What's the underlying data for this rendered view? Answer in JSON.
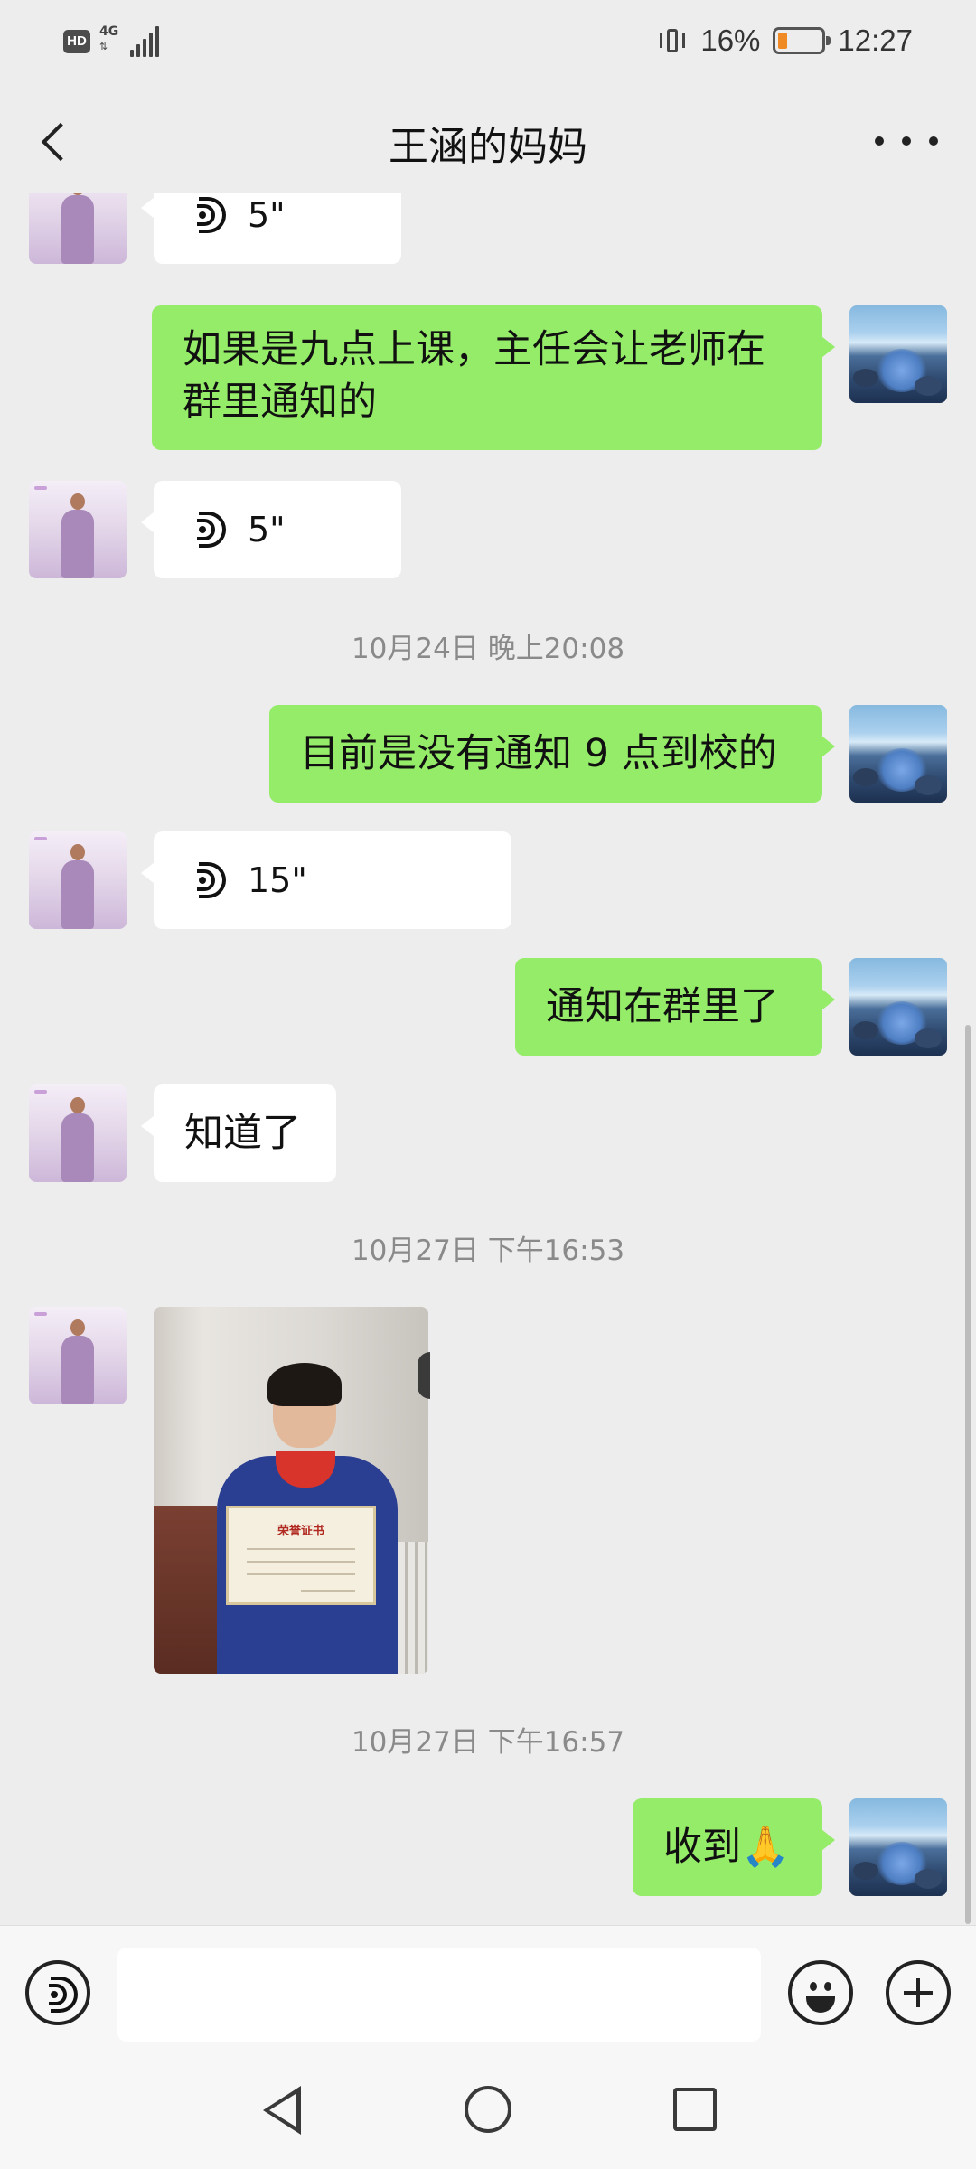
{
  "status_bar": {
    "hd": "HD",
    "network": "4G",
    "battery_text": "16%",
    "battery_level": 0.16,
    "time": "12:27"
  },
  "header": {
    "title": "王涵的妈妈"
  },
  "messages": [
    {
      "type": "voice",
      "from": "other",
      "duration": "5\""
    },
    {
      "type": "text",
      "from": "me",
      "lines": [
        "如果是九点上课，主任会让老师在",
        "群里通知的"
      ]
    },
    {
      "type": "voice",
      "from": "other",
      "duration": "5\""
    },
    {
      "type": "timestamp",
      "text": "10月24日 晚上20:08"
    },
    {
      "type": "text",
      "from": "me",
      "lines": [
        "目前是没有通知 9 点到校的"
      ]
    },
    {
      "type": "voice",
      "from": "other",
      "duration": "15\""
    },
    {
      "type": "text",
      "from": "me",
      "lines": [
        "通知在群里了"
      ]
    },
    {
      "type": "text",
      "from": "other",
      "lines": [
        "知道了"
      ]
    },
    {
      "type": "timestamp",
      "text": "10月27日 下午16:53"
    },
    {
      "type": "image",
      "from": "other",
      "caption_on_certificate": "荣誉证书"
    },
    {
      "type": "timestamp",
      "text": "10月27日 下午16:57"
    },
    {
      "type": "text",
      "from": "me",
      "lines": [
        "收到🙏"
      ]
    }
  ],
  "input_bar": {
    "placeholder": ""
  },
  "icons": {
    "back": "back-icon",
    "more": "more-icon",
    "voice": "voice-icon",
    "emoji": "emoji-icon",
    "plus": "plus-icon"
  },
  "colors": {
    "background": "#ededed",
    "my_bubble": "#95ec69",
    "their_bubble": "#ffffff",
    "timestamp": "#8a8a8a",
    "battery": "#f08a24"
  }
}
